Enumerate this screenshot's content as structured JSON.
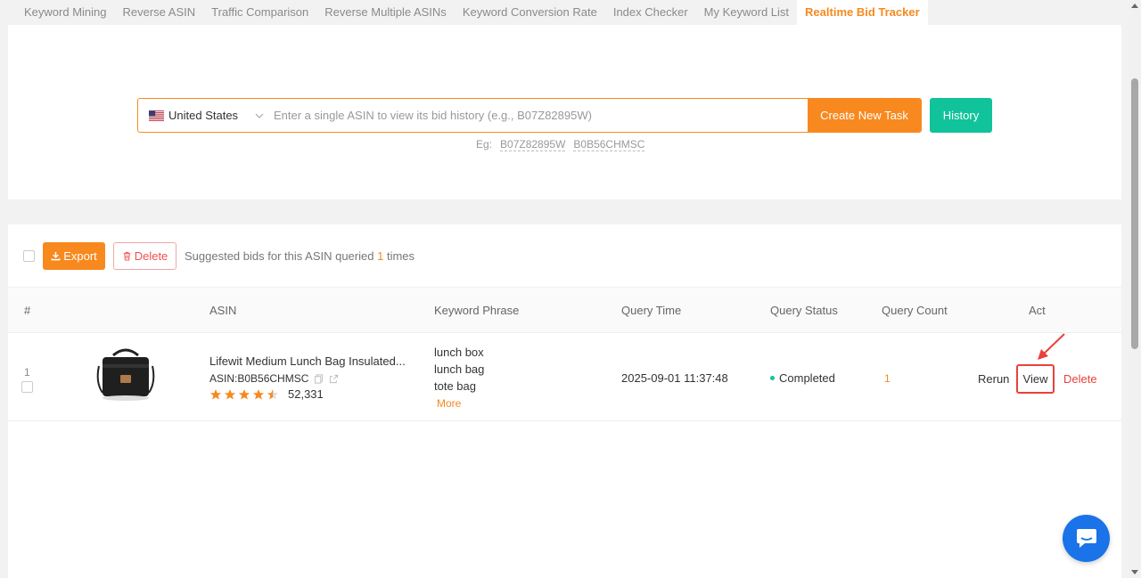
{
  "tabs": [
    {
      "label": "Keyword Mining",
      "active": false
    },
    {
      "label": "Reverse ASIN",
      "active": false
    },
    {
      "label": "Traffic Comparison",
      "active": false
    },
    {
      "label": "Reverse Multiple ASINs",
      "active": false
    },
    {
      "label": "Keyword Conversion Rate",
      "active": false
    },
    {
      "label": "Index Checker",
      "active": false
    },
    {
      "label": "My Keyword List",
      "active": false
    },
    {
      "label": "Realtime Bid Tracker",
      "active": true
    }
  ],
  "search": {
    "country": "United States",
    "placeholder": "Enter a single ASIN to view its bid history (e.g., B07Z82895W)",
    "value": "",
    "create_label": "Create New Task",
    "history_label": "History",
    "examples_prefix": "Eg:",
    "examples": [
      "B07Z82895W",
      "B0B56CHMSC"
    ]
  },
  "toolbar": {
    "export_label": "Export",
    "delete_label": "Delete",
    "suggest_prefix": "Suggested bids for this ASIN queried",
    "suggest_count": "1",
    "suggest_suffix": "times"
  },
  "table": {
    "headers": {
      "index": "#",
      "asin": "ASIN",
      "keyword": "Keyword Phrase",
      "query_time": "Query Time",
      "query_status": "Query Status",
      "query_count": "Query Count",
      "act": "Act"
    },
    "rows": [
      {
        "index": "1",
        "title": "Lifewit Medium Lunch Bag Insulated...",
        "asin": "ASIN:B0B56CHMSC",
        "rating": 4.5,
        "reviews": "52,331",
        "keywords": [
          "lunch box",
          "lunch bag",
          "tote bag"
        ],
        "more": "More",
        "query_time": "2025-09-01 11:37:48",
        "status": "Completed",
        "count": "1",
        "rerun": "Rerun",
        "view": "View",
        "delete": "Delete"
      }
    ]
  },
  "colors": {
    "accent": "#f7891f",
    "success": "#11c39a",
    "danger": "#e8423a",
    "chat": "#1a73e8"
  }
}
